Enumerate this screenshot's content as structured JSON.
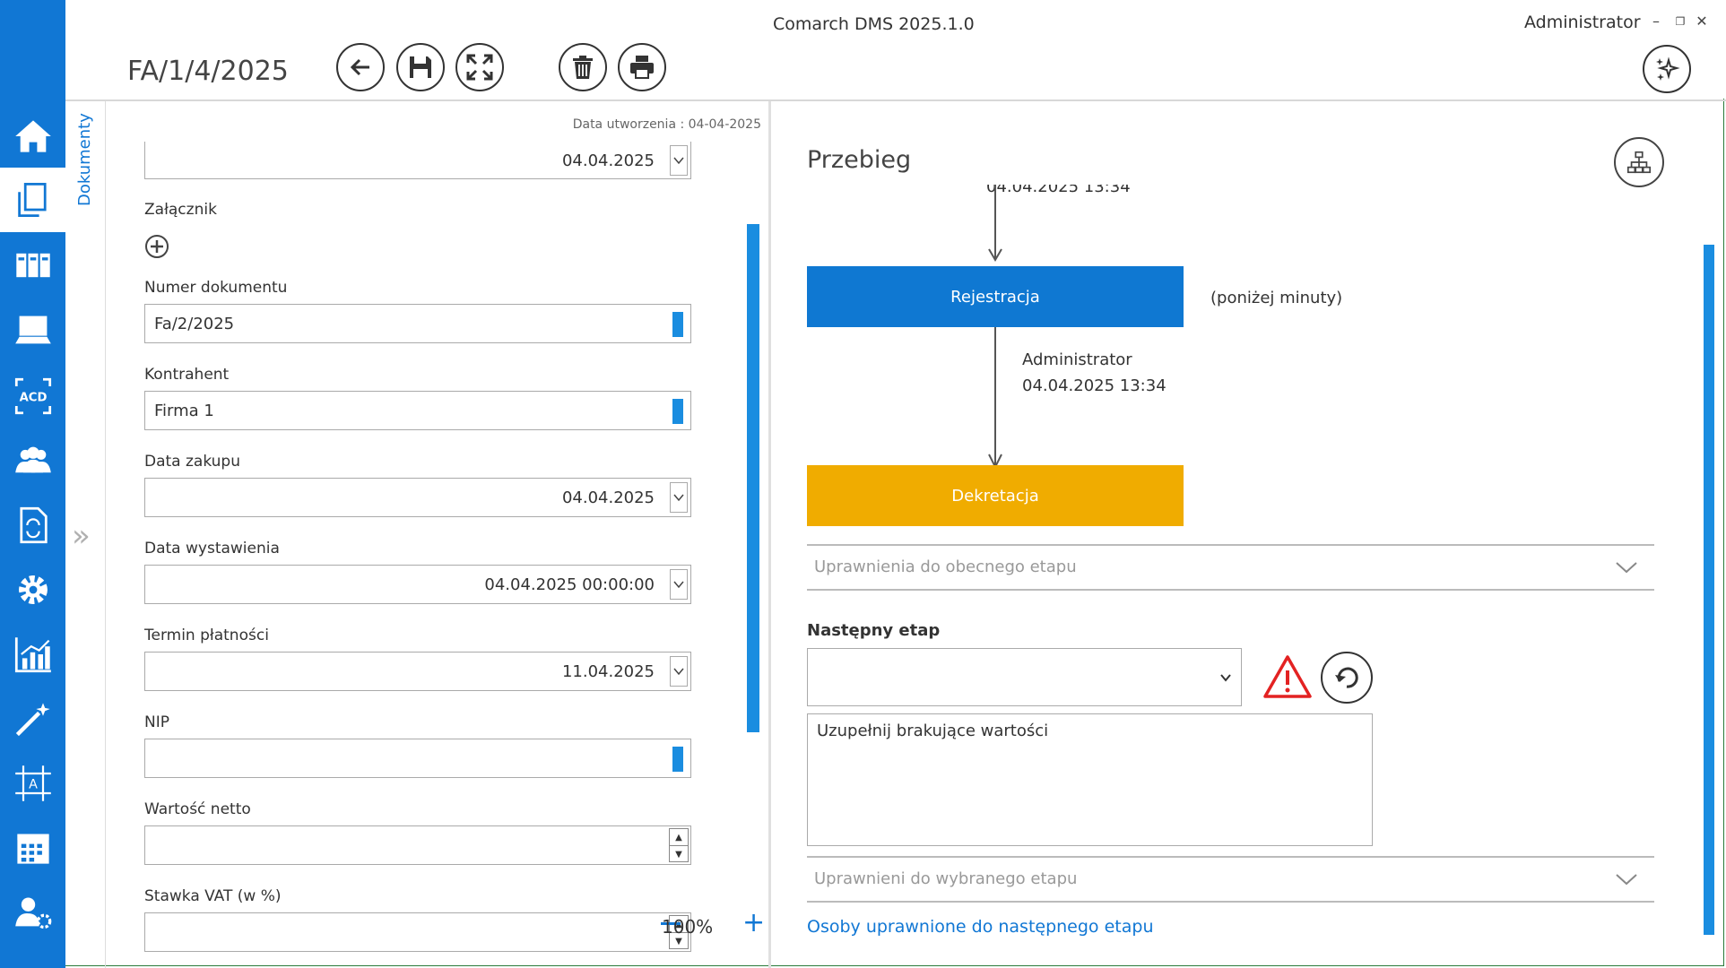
{
  "app": {
    "title": "Comarch DMS 2025.1.0",
    "user": "Administrator"
  },
  "window": {
    "minimize": "–",
    "restore": "❐",
    "close": "✕"
  },
  "document": {
    "title": "FA/1/4/2025",
    "created": "Data utworzenia : 04-04-2025"
  },
  "side_tab": {
    "label": "Dokumenty",
    "collapse": "»"
  },
  "nav": {
    "items": [
      "home-icon",
      "documents-icon",
      "binders-icon",
      "workstation-icon",
      "acd-icon",
      "users-icon",
      "document-sync-icon",
      "gear-icon",
      "chart-icon",
      "magic-wand-icon",
      "template-icon",
      "calendar-icon",
      "user-settings-icon"
    ],
    "active": "documents-icon",
    "accent": "#1177d4"
  },
  "toolbar": {
    "buttons": [
      "back-icon",
      "save-icon",
      "fullscreen-icon",
      "delete-icon",
      "print-icon"
    ]
  },
  "form": {
    "top_date": "04.04.2025",
    "attachment_label": "Załącznik",
    "doc_number_label": "Numer dokumentu",
    "doc_number": "Fa/2/2025",
    "contractor_label": "Kontrahent",
    "contractor": "Firma 1",
    "purchase_date_label": "Data zakupu",
    "purchase_date": "04.04.2025",
    "issue_date_label": "Data wystawienia",
    "issue_date": "04.04.2025 00:00:00",
    "payment_label": "Termin płatności",
    "payment_date": "11.04.2025",
    "nip_label": "NIP",
    "nip": "",
    "net_label": "Wartość netto",
    "net": "",
    "vat_label": "Stawka VAT (w %)",
    "vat": ""
  },
  "workflow": {
    "title": "Przebieg",
    "prev_date": "04.04.2025 13:34",
    "stage1": "Rejestracja",
    "stage1_duration": "(poniżej minuty)",
    "stage1_user": "Administrator",
    "stage1_date": "04.04.2025 13:34",
    "stage2": "Dekretacja",
    "stage1_color": "#0f78d2",
    "stage2_color": "#f0ac00",
    "current_perm": "Uprawnienia do obecnego etapu",
    "next_label": "Następny etap",
    "next_value": "",
    "message": "Uzupełnij brakujące wartości",
    "selected_perm": "Uprawnieni do wybranego etapu",
    "link": "Osoby uprawnione do następnego etapu"
  },
  "zoom": {
    "level": "100%"
  }
}
